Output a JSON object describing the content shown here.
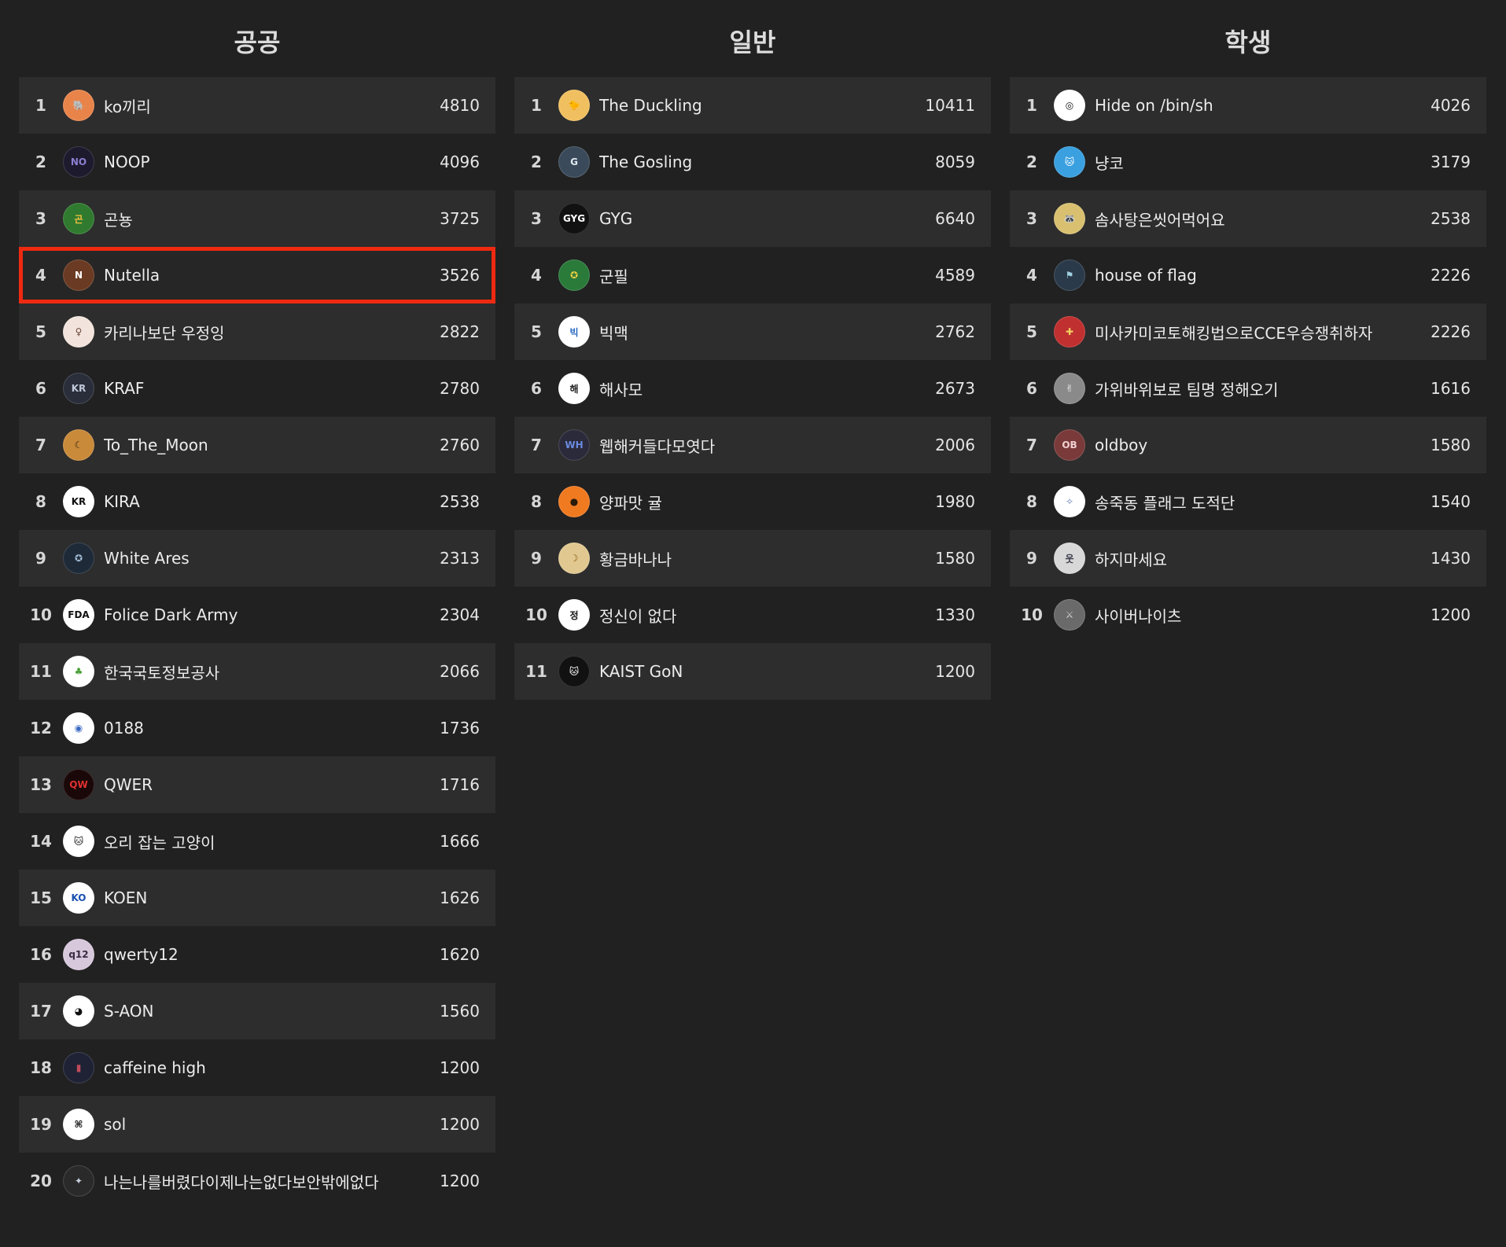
{
  "columns": [
    {
      "title": "공공",
      "rows": [
        {
          "rank": "1",
          "name": "ko끼리",
          "score": "4810",
          "avatar": {
            "glyph": "🐘",
            "bg": "#e8844a",
            "fg": "#3a2a20"
          }
        },
        {
          "rank": "2",
          "name": "NOOP",
          "score": "4096",
          "avatar": {
            "glyph": "NO",
            "bg": "#1e1a2e",
            "fg": "#8a7fd0"
          }
        },
        {
          "rank": "3",
          "name": "곤뇽",
          "score": "3725",
          "avatar": {
            "glyph": "곤",
            "bg": "#2f7a2f",
            "fg": "#f0c040"
          }
        },
        {
          "rank": "4",
          "name": "Nutella",
          "score": "3526",
          "avatar": {
            "glyph": "N",
            "bg": "#6a3a22",
            "fg": "#ffffff"
          }
        },
        {
          "rank": "5",
          "name": "카리나보단 우정잉",
          "score": "2822",
          "avatar": {
            "glyph": "♀",
            "bg": "#f2e4dc",
            "fg": "#6b4a3a"
          }
        },
        {
          "rank": "6",
          "name": "KRAF",
          "score": "2780",
          "avatar": {
            "glyph": "KR",
            "bg": "#2a2e3a",
            "fg": "#c0c8d8"
          }
        },
        {
          "rank": "7",
          "name": "To_The_Moon",
          "score": "2760",
          "avatar": {
            "glyph": "☾",
            "bg": "#c98a3a",
            "fg": "#3a2410"
          }
        },
        {
          "rank": "8",
          "name": "KIRA",
          "score": "2538",
          "avatar": {
            "glyph": "KR",
            "bg": "#ffffff",
            "fg": "#111111"
          }
        },
        {
          "rank": "9",
          "name": "White Ares",
          "score": "2313",
          "avatar": {
            "glyph": "✪",
            "bg": "#1e2a38",
            "fg": "#a8c0d8"
          }
        },
        {
          "rank": "10",
          "name": "Folice Dark Army",
          "score": "2304",
          "avatar": {
            "glyph": "FDA",
            "bg": "#ffffff",
            "fg": "#111111"
          }
        },
        {
          "rank": "11",
          "name": "한국국토정보공사",
          "score": "2066",
          "avatar": {
            "glyph": "♣",
            "bg": "#ffffff",
            "fg": "#4aa03a"
          }
        },
        {
          "rank": "12",
          "name": "0188",
          "score": "1736",
          "avatar": {
            "glyph": "◉",
            "bg": "#ffffff",
            "fg": "#3a6ac0"
          }
        },
        {
          "rank": "13",
          "name": "QWER",
          "score": "1716",
          "avatar": {
            "glyph": "QW",
            "bg": "#1a0808",
            "fg": "#e03030"
          }
        },
        {
          "rank": "14",
          "name": "오리 잡는 고양이",
          "score": "1666",
          "avatar": {
            "glyph": "🐱",
            "bg": "#ffffff",
            "fg": "#222222"
          }
        },
        {
          "rank": "15",
          "name": "KOEN",
          "score": "1626",
          "avatar": {
            "glyph": "KO",
            "bg": "#ffffff",
            "fg": "#1a50b0"
          }
        },
        {
          "rank": "16",
          "name": "qwerty12",
          "score": "1620",
          "avatar": {
            "glyph": "q12",
            "bg": "#d8c8dc",
            "fg": "#3a2a40"
          }
        },
        {
          "rank": "17",
          "name": "S-AON",
          "score": "1560",
          "avatar": {
            "glyph": "◕",
            "bg": "#ffffff",
            "fg": "#111111"
          }
        },
        {
          "rank": "18",
          "name": "caffeine high",
          "score": "1200",
          "avatar": {
            "glyph": "▮",
            "bg": "#1e2234",
            "fg": "#c04a5a"
          }
        },
        {
          "rank": "19",
          "name": "sol",
          "score": "1200",
          "avatar": {
            "glyph": "⌘",
            "bg": "#ffffff",
            "fg": "#111111"
          }
        },
        {
          "rank": "20",
          "name": "나는나를버렸다이제나는없다보안밖에없다",
          "score": "1200",
          "avatar": {
            "glyph": "✦",
            "bg": "#2a2a2a",
            "fg": "#c8d0e0"
          }
        }
      ]
    },
    {
      "title": "일반",
      "rows": [
        {
          "rank": "1",
          "name": "The Duckling",
          "score": "10411",
          "avatar": {
            "glyph": "🐤",
            "bg": "#f0c060",
            "fg": "#3a2a10"
          }
        },
        {
          "rank": "2",
          "name": "The Gosling",
          "score": "8059",
          "avatar": {
            "glyph": "G",
            "bg": "#3a4a5a",
            "fg": "#e0e8f0"
          }
        },
        {
          "rank": "3",
          "name": "GYG",
          "score": "6640",
          "avatar": {
            "glyph": "GYG",
            "bg": "#111111",
            "fg": "#ffffff"
          }
        },
        {
          "rank": "4",
          "name": "군필",
          "score": "4589",
          "avatar": {
            "glyph": "✪",
            "bg": "#2a7a3a",
            "fg": "#f0d040"
          }
        },
        {
          "rank": "5",
          "name": "빅맥",
          "score": "2762",
          "avatar": {
            "glyph": "빅",
            "bg": "#ffffff",
            "fg": "#2a6ac0"
          }
        },
        {
          "rank": "6",
          "name": "해사모",
          "score": "2673",
          "avatar": {
            "glyph": "해",
            "bg": "#ffffff",
            "fg": "#222222"
          }
        },
        {
          "rank": "7",
          "name": "웹해커들다모엿다",
          "score": "2006",
          "avatar": {
            "glyph": "WH",
            "bg": "#2a2a3a",
            "fg": "#6a8ae0"
          }
        },
        {
          "rank": "8",
          "name": "양파맛 귤",
          "score": "1980",
          "avatar": {
            "glyph": "●",
            "bg": "#f07a20",
            "fg": "#2a1a0a"
          }
        },
        {
          "rank": "9",
          "name": "황금바나나",
          "score": "1580",
          "avatar": {
            "glyph": "☽",
            "bg": "#e0c890",
            "fg": "#8a5a10"
          }
        },
        {
          "rank": "10",
          "name": "정신이 없다",
          "score": "1330",
          "avatar": {
            "glyph": "정",
            "bg": "#ffffff",
            "fg": "#111111"
          }
        },
        {
          "rank": "11",
          "name": "KAIST GoN",
          "score": "1200",
          "avatar": {
            "glyph": "🐱",
            "bg": "#111111",
            "fg": "#ffffff"
          }
        }
      ]
    },
    {
      "title": "학생",
      "rows": [
        {
          "rank": "1",
          "name": "Hide on /bin/sh",
          "score": "4026",
          "avatar": {
            "glyph": "◎",
            "bg": "#ffffff",
            "fg": "#111111"
          }
        },
        {
          "rank": "2",
          "name": "냥코",
          "score": "3179",
          "avatar": {
            "glyph": "🐱",
            "bg": "#3aa0e0",
            "fg": "#ffffff"
          }
        },
        {
          "rank": "3",
          "name": "솜사탕은씻어먹어요",
          "score": "2538",
          "avatar": {
            "glyph": "🦝",
            "bg": "#d8c070",
            "fg": "#3a2a10"
          }
        },
        {
          "rank": "4",
          "name": "house of flag",
          "score": "2226",
          "avatar": {
            "glyph": "⚑",
            "bg": "#2a3a4a",
            "fg": "#a0d0e0"
          }
        },
        {
          "rank": "5",
          "name": "미사카미코토해킹법으로CCE우승쟁취하자",
          "score": "2226",
          "avatar": {
            "glyph": "✚",
            "bg": "#c03030",
            "fg": "#f0d060"
          }
        },
        {
          "rank": "6",
          "name": "가위바위보로 팀명 정해오기",
          "score": "1616",
          "avatar": {
            "glyph": "✌",
            "bg": "#8a8a8a",
            "fg": "#f0f0f0"
          }
        },
        {
          "rank": "7",
          "name": "oldboy",
          "score": "1580",
          "avatar": {
            "glyph": "OB",
            "bg": "#7a3a3a",
            "fg": "#f0d0d0"
          }
        },
        {
          "rank": "8",
          "name": "송죽동 플래그 도적단",
          "score": "1540",
          "avatar": {
            "glyph": "✧",
            "bg": "#ffffff",
            "fg": "#5a7ab0"
          }
        },
        {
          "rank": "9",
          "name": "하지마세요",
          "score": "1430",
          "avatar": {
            "glyph": "웃",
            "bg": "#d8d8d8",
            "fg": "#3a3a4a"
          }
        },
        {
          "rank": "10",
          "name": "사이버나이츠",
          "score": "1200",
          "avatar": {
            "glyph": "⚔",
            "bg": "#6a6a6a",
            "fg": "#d0d0d0"
          }
        }
      ]
    }
  ],
  "highlight": {
    "column": 0,
    "rank": "4",
    "color": "#ee2a11"
  }
}
